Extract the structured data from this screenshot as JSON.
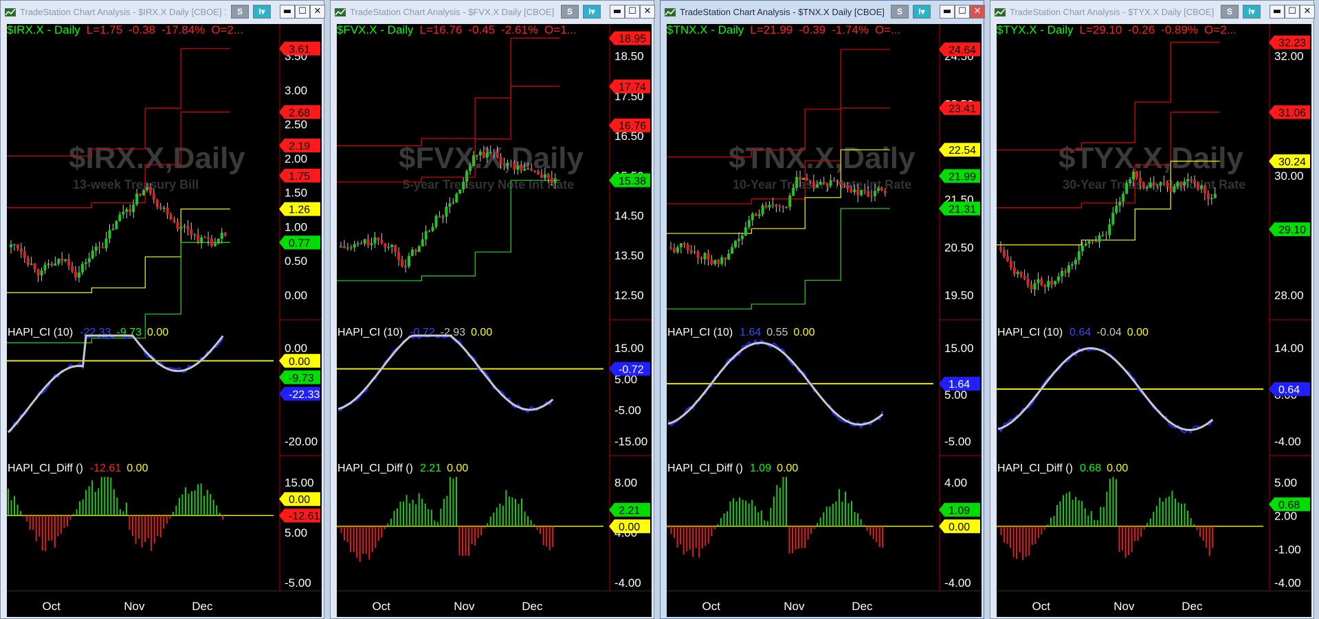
{
  "window_controls": {
    "s_label": "S",
    "i_label": "I",
    "minimize": "▬",
    "maximize": "☐",
    "close": "✕"
  },
  "panels": [
    {
      "id": "irx",
      "active": false,
      "title": "TradeStation Chart Analysis - $IRX.X Daily [CBOE] 13-...",
      "header": {
        "symbol": "$IRX.X - Daily",
        "last": "L=1.75",
        "chg": "-0.38",
        "pct": "-17.84%",
        "open": "O=2..."
      },
      "watermark": {
        "symbol": "$IRX.X,Daily",
        "desc": "13-week Treasury Bill"
      },
      "price_ticks": [
        "3.50",
        "3.00",
        "2.50",
        "2.00",
        "1.50",
        "1.00",
        "0.50",
        "0.00"
      ],
      "price_tags": [
        {
          "text": "3.61",
          "color": "#ff1a1a"
        },
        {
          "text": "2.68",
          "color": "#ff1a1a"
        },
        {
          "text": "2.19",
          "color": "#ff1a1a"
        },
        {
          "text": "1.75",
          "color": "#ff1a1a"
        },
        {
          "text": "1.26",
          "color": "#ffff00"
        },
        {
          "text": "0.77",
          "color": "#00dd00"
        }
      ],
      "ind1": {
        "label": "HAPI_CI (10)",
        "v1": "-22.33",
        "v2": "-9.73",
        "v3": "0.00",
        "v1_color": "#2f4dff",
        "v2_color": "#00ff00"
      },
      "ind1_ticks": [
        "0.00",
        "-20.00"
      ],
      "ind1_tags": [
        {
          "text": "0.00",
          "color": "#ffff00"
        },
        {
          "text": "-9.73",
          "color": "#00dd00"
        },
        {
          "text": "-22.33",
          "color": "#2020ff"
        }
      ],
      "ind2": {
        "label": "HAPI_CI_Diff ()",
        "v1": "-12.61",
        "v2": "0.00",
        "v1_color": "#ff2020"
      },
      "ind2_ticks": [
        "15.00",
        "5.00",
        "-5.00"
      ],
      "ind2_tags": [
        {
          "text": "0.00",
          "color": "#ffff00"
        },
        {
          "text": "-12.61",
          "color": "#ff1a1a"
        }
      ],
      "months": [
        "Oct",
        "Nov",
        "Dec"
      ]
    },
    {
      "id": "fvx",
      "active": false,
      "title": "TradeStation Chart Analysis - $FVX.X Daily [CBOE] 5-y...",
      "header": {
        "symbol": "$FVX.X - Daily",
        "last": "L=16.76",
        "chg": "-0.45",
        "pct": "-2.61%",
        "open": "O=1..."
      },
      "watermark": {
        "symbol": "$FVX.X,Daily",
        "desc": "5-year Treasury Note Int Rate"
      },
      "price_ticks": [
        "18.50",
        "17.50",
        "16.50",
        "15.50",
        "14.50",
        "13.50",
        "12.50"
      ],
      "price_tags": [
        {
          "text": "18.95",
          "color": "#ff1a1a"
        },
        {
          "text": "17.74",
          "color": "#ff1a1a"
        },
        {
          "text": "16.76",
          "color": "#ff1a1a"
        },
        {
          "text": "15.38",
          "color": "#00dd00"
        }
      ],
      "ind1": {
        "label": "HAPI_CI (10)",
        "v1": "-0.72",
        "v2": "-2.93",
        "v3": "0.00",
        "v1_color": "#2f4dff",
        "v2_color": "#c8c8c8"
      },
      "ind1_ticks": [
        "15.00",
        "5.00",
        "-5.00",
        "-15.00"
      ],
      "ind1_tags": [
        {
          "text": "-0.72",
          "color": "#2020ff"
        }
      ],
      "ind2": {
        "label": "HAPI_CI_Diff ()",
        "v1": "2.21",
        "v2": "0.00",
        "v1_color": "#00ff00"
      },
      "ind2_ticks": [
        "8.00",
        "4.00",
        "-4.00"
      ],
      "ind2_tags": [
        {
          "text": "2.21",
          "color": "#00dd00"
        },
        {
          "text": "0.00",
          "color": "#ffff00"
        }
      ],
      "months": [
        "Oct",
        "Nov",
        "Dec"
      ]
    },
    {
      "id": "tnx",
      "active": true,
      "title": "TradeStation Chart Analysis - $TNX.X Daily [CBOE] 10-...",
      "header": {
        "symbol": "$TNX.X - Daily",
        "last": "L=21.99",
        "chg": "-0.39",
        "pct": "-1.74%",
        "open": "O=..."
      },
      "watermark": {
        "symbol": "$TNX.X,Daily",
        "desc": "10-Year Treasury Note Int Rate"
      },
      "price_ticks": [
        "24.50",
        "23.50",
        "22.50",
        "21.50",
        "20.50",
        "19.50"
      ],
      "price_tags": [
        {
          "text": "24.64",
          "color": "#ff1a1a"
        },
        {
          "text": "23.41",
          "color": "#ff1a1a"
        },
        {
          "text": "22.54",
          "color": "#ffff00"
        },
        {
          "text": "21.99",
          "color": "#00dd00"
        },
        {
          "text": "21.31",
          "color": "#00dd00"
        }
      ],
      "ind1": {
        "label": "HAPI_CI (10)",
        "v1": "1.64",
        "v2": "0.55",
        "v3": "0.00",
        "v1_color": "#2f4dff",
        "v2_color": "#c8c8c8"
      },
      "ind1_ticks": [
        "15.00",
        "5.00",
        "-5.00"
      ],
      "ind1_tags": [
        {
          "text": "1.64",
          "color": "#2020ff"
        }
      ],
      "ind2": {
        "label": "HAPI_CI_Diff ()",
        "v1": "1.09",
        "v2": "0.00",
        "v1_color": "#00ff00"
      },
      "ind2_ticks": [
        "4.00",
        "-4.00"
      ],
      "ind2_tags": [
        {
          "text": "1.09",
          "color": "#00dd00"
        },
        {
          "text": "0.00",
          "color": "#ffff00"
        }
      ],
      "months": [
        "Oct",
        "Nov",
        "Dec"
      ]
    },
    {
      "id": "tyx",
      "active": false,
      "title": "TradeStation Chart Analysis - $TYX.X Daily [CBOE] 30-...",
      "header": {
        "symbol": "$TYX.X - Daily",
        "last": "L=29.10",
        "chg": "-0.26",
        "pct": "-0.89%",
        "open": "O=2..."
      },
      "watermark": {
        "symbol": "$TYX.X,Daily",
        "desc": "30-Year Treasury Bond Int Rate"
      },
      "price_ticks": [
        "32.00",
        "30.00",
        "28.00"
      ],
      "price_tags": [
        {
          "text": "32.23",
          "color": "#ff1a1a"
        },
        {
          "text": "31.06",
          "color": "#ff1a1a"
        },
        {
          "text": "30.24",
          "color": "#ffff00"
        },
        {
          "text": "29.10",
          "color": "#00dd00"
        }
      ],
      "ind1": {
        "label": "HAPI_CI (10)",
        "v1": "0.64",
        "v2": "-0.04",
        "v3": "0.00",
        "v1_color": "#2f4dff",
        "v2_color": "#c8c8c8"
      },
      "ind1_ticks": [
        "14.00",
        "8.00",
        "-4.00"
      ],
      "ind1_tags": [
        {
          "text": "0.64",
          "color": "#2020ff"
        }
      ],
      "ind2": {
        "label": "HAPI_CI_Diff ()",
        "v1": "0.68",
        "v2": "0.00",
        "v1_color": "#00ff00"
      },
      "ind2_ticks": [
        "5.00",
        "2.00",
        "-1.00",
        "-4.00"
      ],
      "ind2_tags": [
        {
          "text": "0.68",
          "color": "#00dd00"
        }
      ],
      "months": [
        "Oct",
        "Nov",
        "Dec"
      ]
    }
  ],
  "chart_data": [
    {
      "type": "line",
      "symbol": "$IRX.X",
      "subtitle": "13-week Treasury Bill",
      "price_axis": {
        "ylim": [
          0,
          3.5
        ]
      },
      "bands": {
        "upper_red": 3.61,
        "mid_red": [
          2.68,
          2.19
        ],
        "yellow": 1.26,
        "green": 0.77
      },
      "last": 1.75,
      "ci": {
        "values": [
          -22.33,
          -9.73
        ],
        "zero_line": 0.0
      },
      "diff": {
        "last": -12.61,
        "zero_line": 0.0
      },
      "x_months": [
        "Oct",
        "Nov",
        "Dec"
      ]
    },
    {
      "type": "line",
      "symbol": "$FVX.X",
      "subtitle": "5-year Treasury Note Int Rate",
      "price_axis": {
        "ylim": [
          12.5,
          18.5
        ]
      },
      "bands": {
        "upper_red": 18.95,
        "mid_red": [
          17.74
        ],
        "green": 15.38
      },
      "last": 16.76,
      "ci": {
        "values": [
          -0.72,
          -2.93
        ],
        "zero_line": 0.0
      },
      "diff": {
        "last": 2.21,
        "zero_line": 0.0
      },
      "x_months": [
        "Oct",
        "Nov",
        "Dec"
      ]
    },
    {
      "type": "line",
      "symbol": "$TNX.X",
      "subtitle": "10-Year Treasury Note Int Rate",
      "price_axis": {
        "ylim": [
          19.5,
          24.5
        ]
      },
      "bands": {
        "upper_red": 24.64,
        "mid_red": [
          23.41
        ],
        "yellow": 22.54,
        "green": 21.31
      },
      "last": 21.99,
      "ci": {
        "values": [
          1.64,
          0.55
        ],
        "zero_line": 0.0
      },
      "diff": {
        "last": 1.09,
        "zero_line": 0.0
      },
      "x_months": [
        "Oct",
        "Nov",
        "Dec"
      ]
    },
    {
      "type": "line",
      "symbol": "$TYX.X",
      "subtitle": "30-Year Treasury Bond Int Rate",
      "price_axis": {
        "ylim": [
          28,
          32
        ]
      },
      "bands": {
        "upper_red": 32.23,
        "mid_red": [
          31.06
        ],
        "yellow": 30.24
      },
      "last": 29.1,
      "ci": {
        "values": [
          0.64,
          -0.04
        ],
        "zero_line": 0.0
      },
      "diff": {
        "last": 0.68,
        "zero_line": 0.0
      },
      "x_months": [
        "Oct",
        "Nov",
        "Dec"
      ]
    }
  ]
}
